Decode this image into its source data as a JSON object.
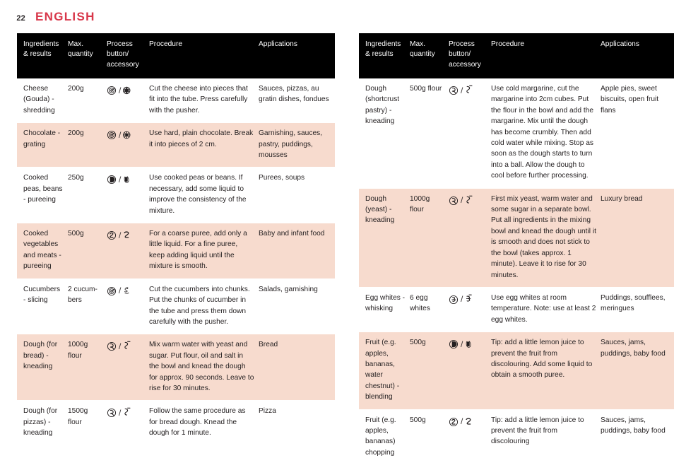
{
  "header": {
    "page_number": "22",
    "title": "ENGLISH",
    "title_color": "#d8374a"
  },
  "theme": {
    "head_bg": "#000000",
    "head_fg": "#ffffff",
    "shade_row_bg": "#f7dbce",
    "plain_row_bg": "#ffffff",
    "text": "#231f20"
  },
  "columns": [
    "Ingredients & results",
    "Max. quantity",
    "Process button/ accessory",
    "Procedure",
    "Applications"
  ],
  "tables": [
    {
      "id": "left",
      "headers": {
        "ingredients": "Ingredients & results",
        "quantity": "Max. quantity",
        "process": "Process button/ accessory",
        "procedure": "Procedure",
        "applications": "Applications"
      },
      "rows": [
        {
          "shaded": false,
          "ingredients": "Cheese (Gouda) - shredding",
          "quantity": "200g",
          "icons": [
            "speed-dial-icon",
            "shredding-disc-icon"
          ],
          "procedure": "Cut the cheese into pieces that fit into the tube. Press carefully with the pusher.",
          "applications": "Sauces, pizzas, au gratin dishes, fondues"
        },
        {
          "shaded": true,
          "ingredients": "Chocolate - grating",
          "quantity": "200g",
          "icons": [
            "speed-dial-icon",
            "grating-disc-icon"
          ],
          "procedure": "Use hard, plain chocolate. Break it into pieces of 2 cm.",
          "applications": "Garnishing, sauces, pastry, puddings, mousses"
        },
        {
          "shaded": false,
          "ingredients": "Cooked peas, beans - pureeing",
          "quantity": "250g",
          "icons": [
            "pulse-button-icon",
            "blender-jar-icon"
          ],
          "procedure": "Use cooked peas or beans. If necessary, add some liquid to improve the consistency of the mixture.",
          "applications": "Purees, soups"
        },
        {
          "shaded": true,
          "ingredients": "Cooked vegetables and meats - pureeing",
          "quantity": "500g",
          "icons": [
            "speed-two-button-icon",
            "chopping-blade-icon"
          ],
          "procedure": "For a coarse puree, add only a little liquid. For a fine puree, keep adding liquid until the mixture is smooth.",
          "applications": "Baby and infant food"
        },
        {
          "shaded": false,
          "ingredients": "Cucumbers - slicing",
          "quantity": "2 cucum-bers",
          "icons": [
            "speed-dial-icon",
            "slicing-disc-icon"
          ],
          "procedure": "Cut the cucumbers into chunks. Put the chunks of cucumber in the tube and press them down carefully with the pusher.",
          "applications": "Salads, garnishing"
        },
        {
          "shaded": true,
          "ingredients": "Dough (for bread) - kneading",
          "quantity": "1000g flour",
          "icons": [
            "kneading-button-icon",
            "kneading-hook-icon"
          ],
          "procedure": "Mix warm water with yeast and sugar. Put flour, oil and salt in the bowl and knead the dough for approx. 90 seconds. Leave to rise for 30 minutes.",
          "applications": "Bread"
        },
        {
          "shaded": false,
          "ingredients": "Dough (for pizzas) - kneading",
          "quantity": "1500g flour",
          "icons": [
            "kneading-button-icon",
            "kneading-hook-icon"
          ],
          "procedure": "Follow the same procedure as for bread dough. Knead the dough for 1 minute.",
          "applications": "Pizza"
        }
      ]
    },
    {
      "id": "right",
      "headers": {
        "ingredients": "Ingredients & results",
        "quantity": "Max. quantity",
        "process": "Process button/ accessory",
        "procedure": "Procedure",
        "applications": "Applications"
      },
      "rows": [
        {
          "shaded": false,
          "ingredients": "Dough (shortcrust pastry) - kneading",
          "quantity": "500g flour",
          "icons": [
            "kneading-button-icon",
            "kneading-hook-icon"
          ],
          "procedure": "Use cold margarine, cut the margarine into 2cm cubes. Put the flour in the bowl and add the margarine. Mix until the dough has become crumbly. Then add cold water while mixing. Stop as soon as the dough starts to turn into a ball. Allow the dough to cool before further processing.",
          "applications": "Apple pies, sweet biscuits, open fruit flans"
        },
        {
          "shaded": true,
          "ingredients": "Dough (yeast) - kneading",
          "quantity": "1000g flour",
          "icons": [
            "kneading-button-icon",
            "kneading-hook-icon"
          ],
          "procedure": "First mix yeast, warm water and some sugar in a separate bowl. Put all ingredients in the mixing bowl and knead the dough until it is smooth and does not stick to the bowl (takes approx. 1 minute). Leave it to rise for 30 minutes.",
          "applications": "Luxury bread"
        },
        {
          "shaded": false,
          "ingredients": "Egg whites - whisking",
          "quantity": "6 egg whites",
          "icons": [
            "whisking-button-icon",
            "balloon-whisk-icon"
          ],
          "procedure": "Use egg whites at room temperature. Note: use at least 2 egg whites.",
          "applications": "Puddings, soufflees, meringues"
        },
        {
          "shaded": true,
          "ingredients": "Fruit (e.g. apples, bananas, water chestnut) - blending",
          "quantity": "500g",
          "icons": [
            "pulse-button-icon",
            "blender-jar-icon"
          ],
          "procedure": "Tip: add a little lemon juice to prevent the fruit from discolouring. Add some liquid to obtain a smooth puree.",
          "applications": "Sauces, jams, puddings, baby food"
        },
        {
          "shaded": false,
          "ingredients": "Fruit (e.g. apples, bananas) chopping",
          "quantity": "500g",
          "icons": [
            "speed-two-button-icon",
            "chopping-blade-icon"
          ],
          "procedure": "Tip: add a little lemon juice to prevent the fruit from discolouring",
          "applications": "Sauces, jams, puddings, baby food"
        }
      ]
    }
  ]
}
